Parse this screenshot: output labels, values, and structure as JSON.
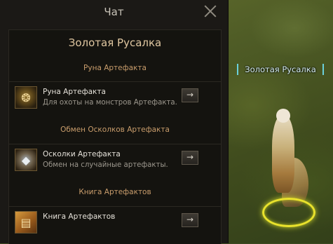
{
  "chat_window": {
    "title": "Чат",
    "npc_name": "Золотая Русалка",
    "sections": [
      {
        "heading": "Руна Артефакта",
        "item_title": "Руна Артефакта",
        "item_desc": "Для охоты на монстров Артефакта.",
        "button_label": "→",
        "icon": "artifact-rune-icon"
      },
      {
        "heading": "Обмен Осколков Артефакта",
        "item_title": "Осколки Артефакта",
        "item_desc": "Обмен на случайные артефакты.",
        "button_label": "→",
        "icon": "artifact-shard-icon"
      },
      {
        "heading": "Книга Артефактов",
        "item_title": "Книга Артефактов",
        "item_desc": "",
        "button_label": "→",
        "icon": "artifact-book-icon"
      }
    ]
  },
  "world": {
    "npc_label": "Золотая Русалка"
  },
  "colors": {
    "panel_bg": "#1b1916",
    "heading_text": "#c99d6c",
    "npc_name_text": "#e0c7a1",
    "npc_label_bracket": "#6ad0dc",
    "selection_ring": "#e9e22c"
  }
}
